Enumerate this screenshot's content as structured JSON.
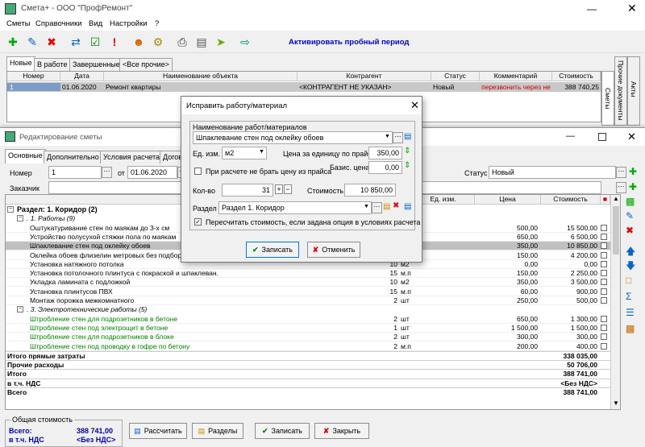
{
  "main_window": {
    "title": "Смета+ - ООО \"ПрофРемонт\"",
    "menu": [
      "Сметы",
      "Справочники",
      "Вид",
      "Настройки",
      "?"
    ],
    "activate_text": "Активировать пробный период",
    "tabs": [
      "Новые",
      "В работе",
      "Завершенные",
      "<Все прочие>"
    ],
    "columns": [
      "Номер",
      "Дата",
      "Наименование объекта",
      "Контрагент",
      "Статус",
      "Комментарий",
      "Стоимость"
    ],
    "rows": [
      {
        "num": "1",
        "date": "01.06.2020",
        "name": "Ремонт квартиры",
        "agent": "<КОНТРАГЕНТ НЕ УКАЗАН>",
        "status": "Новый",
        "comment": "перезвонить через не",
        "cost": "388 740,25"
      }
    ],
    "side_tabs": [
      "Акты",
      "Прочие документы",
      "Сметы"
    ],
    "accent_color": "#0000cc",
    "comment_color": "#cc0000"
  },
  "editor_window": {
    "title": "Редактирование сметы",
    "tabs": [
      "Основные",
      "Дополнительно",
      "Условия расчета",
      "Догов"
    ],
    "number_label": "Номер",
    "number_value": "1",
    "from_label": "от",
    "date_value": "01.06.2020",
    "status_label": "Статус",
    "status_value": "Новый",
    "customer_label": "Заказчик",
    "columns": [
      "Наименова",
      "Ед. изм.",
      "Цена",
      "Стоимость"
    ],
    "section_title": "Раздел:  1. Коридор (2)",
    "groups": [
      {
        "title": ". 1. Работы (9)",
        "items": [
          {
            "name": "Оштукатуривание стен по маякам до 3-х см",
            "qty": "",
            "unit": "",
            "price": "500,00",
            "cost": "15 500,00"
          },
          {
            "name": "Устройство полусухой стяжки пола по маякам",
            "qty": "",
            "unit": "",
            "price": "650,00",
            "cost": "6 500,00"
          },
          {
            "name": "Шпаклевание стен под оклейку обоев",
            "qty": "",
            "unit": "",
            "price": "350,00",
            "cost": "10 850,00"
          },
          {
            "name": "Оклейка обоев флизелин метровых без подбора",
            "qty": "",
            "unit": "",
            "price": "150,00",
            "cost": "4 200,00"
          },
          {
            "name": "Установка натяжного потолка",
            "qty": "10",
            "unit": "м2",
            "price": "0,00",
            "cost": "0,00"
          },
          {
            "name": "Установка потолочного плинтуса с покраской и шпаклеван.",
            "qty": "15",
            "unit": "м.п",
            "price": "150,00",
            "cost": "2 250,00"
          },
          {
            "name": "Укладка ламината с подложкой",
            "qty": "10",
            "unit": "м2",
            "price": "350,00",
            "cost": "3 500,00"
          },
          {
            "name": "Установка плинтусов ПВХ",
            "qty": "15",
            "unit": "м.п",
            "price": "60,00",
            "cost": "900,00"
          },
          {
            "name": "Монтаж порожка межкомнатного",
            "qty": "2",
            "unit": "шт",
            "price": "250,00",
            "cost": "500,00"
          }
        ]
      },
      {
        "title": ". 3. Электротехнические работы (5)",
        "items": [
          {
            "name": "Штробление стен для подрозетников в бетоне",
            "qty": "2",
            "unit": "шт",
            "price": "650,00",
            "cost": "1 300,00"
          },
          {
            "name": "Штробление стен под электрощит в бетоне",
            "qty": "1",
            "unit": "шт",
            "price": "1 500,00",
            "cost": "1 500,00"
          },
          {
            "name": "Штробление стен для подрозетников в блоке",
            "qty": "2",
            "unit": "шт",
            "price": "300,00",
            "cost": "300,00"
          },
          {
            "name": "Штробление стен под проводку в гофре по бетону",
            "qty": "2",
            "unit": "м.п",
            "price": "200,00",
            "cost": "400,00"
          }
        ]
      }
    ],
    "totals": [
      {
        "label": "Итого прямые затраты",
        "value": "338 035,00"
      },
      {
        "label": "Прочие расходы",
        "value": "50 706,00"
      },
      {
        "label": "Итого",
        "value": "388 741,00"
      },
      {
        "label": "в т.ч. НДС",
        "value": "<Без НДС>"
      },
      {
        "label": "Всего",
        "value": "388 741,00"
      }
    ],
    "summary_title": "Общая стоимость",
    "summary_total_label": "Всего:",
    "summary_total_value": "388 741,00",
    "summary_vat_label": "в т.ч. НДС",
    "summary_vat_value": "<Без НДС>",
    "buttons": {
      "calc": "Рассчитать",
      "sections": "Разделы",
      "save": "Записать",
      "close": "Закрыть"
    },
    "green_text_color": "#008000",
    "selected_row_color": "#c0c0c0"
  },
  "dialog": {
    "title": "Исправить работу/материал",
    "name_label": "Наименование работ/материалов",
    "name_value": "Шпаклевание стен под оклейку обоев",
    "unit_label": "Ед. изм.",
    "unit_value": "м2",
    "price_label": "Цена за единицу по прайсу",
    "price_value": "350,00",
    "base_price_label": "Базис. цена",
    "base_price_value": "0,00",
    "no_price_checkbox": "При расчете не брать цену из прайса",
    "qty_label": "Кол-во",
    "qty_value": "31",
    "cost_label": "Стоимость",
    "cost_value": "10 850,00",
    "section_label": "Раздел",
    "section_value": "Раздел 1. Коридор",
    "recalc_checkbox": "Пересчитать стоимость, если задана опция в условиях расчета",
    "ok_label": "Записать",
    "cancel_label": "Отменить"
  }
}
